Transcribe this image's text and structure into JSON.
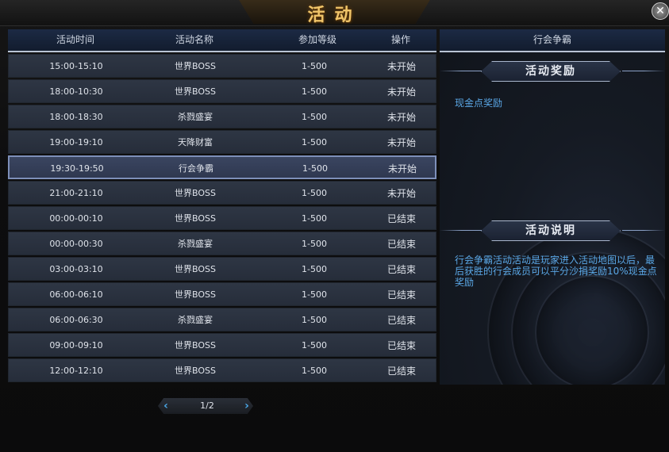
{
  "window": {
    "title": "活动",
    "close_label": "✕"
  },
  "table": {
    "headers": {
      "time": "活动时间",
      "name": "活动名称",
      "level": "参加等级",
      "op": "操作"
    },
    "rows": [
      {
        "time": "15:00-15:10",
        "name": "世界BOSS",
        "level": "1-500",
        "op": "未开始"
      },
      {
        "time": "18:00-10:30",
        "name": "世界BOSS",
        "level": "1-500",
        "op": "未开始"
      },
      {
        "time": "18:00-18:30",
        "name": "杀戮盛宴",
        "level": "1-500",
        "op": "未开始"
      },
      {
        "time": "19:00-19:10",
        "name": "天降财富",
        "level": "1-500",
        "op": "未开始"
      },
      {
        "time": "19:30-19:50",
        "name": "行会争霸",
        "level": "1-500",
        "op": "未开始"
      },
      {
        "time": "21:00-21:10",
        "name": "世界BOSS",
        "level": "1-500",
        "op": "未开始"
      },
      {
        "time": "00:00-00:10",
        "name": "世界BOSS",
        "level": "1-500",
        "op": "已结束"
      },
      {
        "time": "00:00-00:30",
        "name": "杀戮盛宴",
        "level": "1-500",
        "op": "已结束"
      },
      {
        "time": "03:00-03:10",
        "name": "世界BOSS",
        "level": "1-500",
        "op": "已结束"
      },
      {
        "time": "06:00-06:10",
        "name": "世界BOSS",
        "level": "1-500",
        "op": "已结束"
      },
      {
        "time": "06:00-06:30",
        "name": "杀戮盛宴",
        "level": "1-500",
        "op": "已结束"
      },
      {
        "time": "09:00-09:10",
        "name": "世界BOSS",
        "level": "1-500",
        "op": "已结束"
      },
      {
        "time": "12:00-12:10",
        "name": "世界BOSS",
        "level": "1-500",
        "op": "已结束"
      }
    ],
    "selected_index": 4
  },
  "pager": {
    "text": "1/2",
    "prev_icon": "chevron-left-icon",
    "next_icon": "chevron-right-icon"
  },
  "detail": {
    "title": "行会争霸",
    "reward_heading": "活动奖励",
    "reward_text": "现金点奖励",
    "desc_heading": "活动说明",
    "desc_text": "行会争霸活动活动是玩家进入活动地图以后，最后获胜的行会成员可以平分沙捐奖励10%现金点奖励"
  },
  "colors": {
    "accent_text": "#5aa7e6",
    "title_gold": "#f0c56a",
    "selected_border": "#7d8fb9"
  }
}
